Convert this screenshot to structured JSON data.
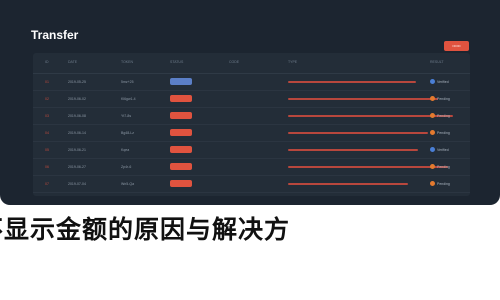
{
  "window": {
    "title": "Transfer",
    "action_button_label": "••••••"
  },
  "table": {
    "headers": [
      "ID",
      "DATE",
      "TOKEN",
      "STATUS",
      "CODE",
      "TYPE",
      "RESULT"
    ],
    "rows": [
      {
        "idx": "01",
        "date": "2019-05-25",
        "token": "5mz+25",
        "pill_color": "#5b7fc7",
        "bar_w": 128,
        "status": "Verified",
        "dot_color": "#4a7fd6"
      },
      {
        "idx": "02",
        "date": "2019-06-02",
        "token": "Kl6gw1-4",
        "pill_color": "#e0533f",
        "bar_w": 150,
        "status": "Pending",
        "dot_color": "#e37a2f"
      },
      {
        "idx": "03",
        "date": "2019-06-08",
        "token": "Yt7-8s",
        "pill_color": "#e0533f",
        "bar_w": 165,
        "status": "Pending",
        "dot_color": "#e37a2f"
      },
      {
        "idx": "04",
        "date": "2019-06-14",
        "token": "Bg48-Lz",
        "pill_color": "#e0533f",
        "bar_w": 140,
        "status": "Pending",
        "dot_color": "#e37a2f"
      },
      {
        "idx": "05",
        "date": "2019-06-21",
        "token": "Kqea",
        "pill_color": "#e0533f",
        "bar_w": 130,
        "status": "Verified",
        "dot_color": "#4a7fd6"
      },
      {
        "idx": "06",
        "date": "2019-06-27",
        "token": "Zp4r-6",
        "pill_color": "#e0533f",
        "bar_w": 160,
        "status": "Pending",
        "dot_color": "#e37a2f"
      },
      {
        "idx": "07",
        "date": "2019-07-04",
        "token": "Wn5-Qa",
        "pill_color": "#e0533f",
        "bar_w": 120,
        "status": "Pending",
        "dot_color": "#e37a2f"
      }
    ]
  },
  "caption": "不显示金额的原因与解决方"
}
